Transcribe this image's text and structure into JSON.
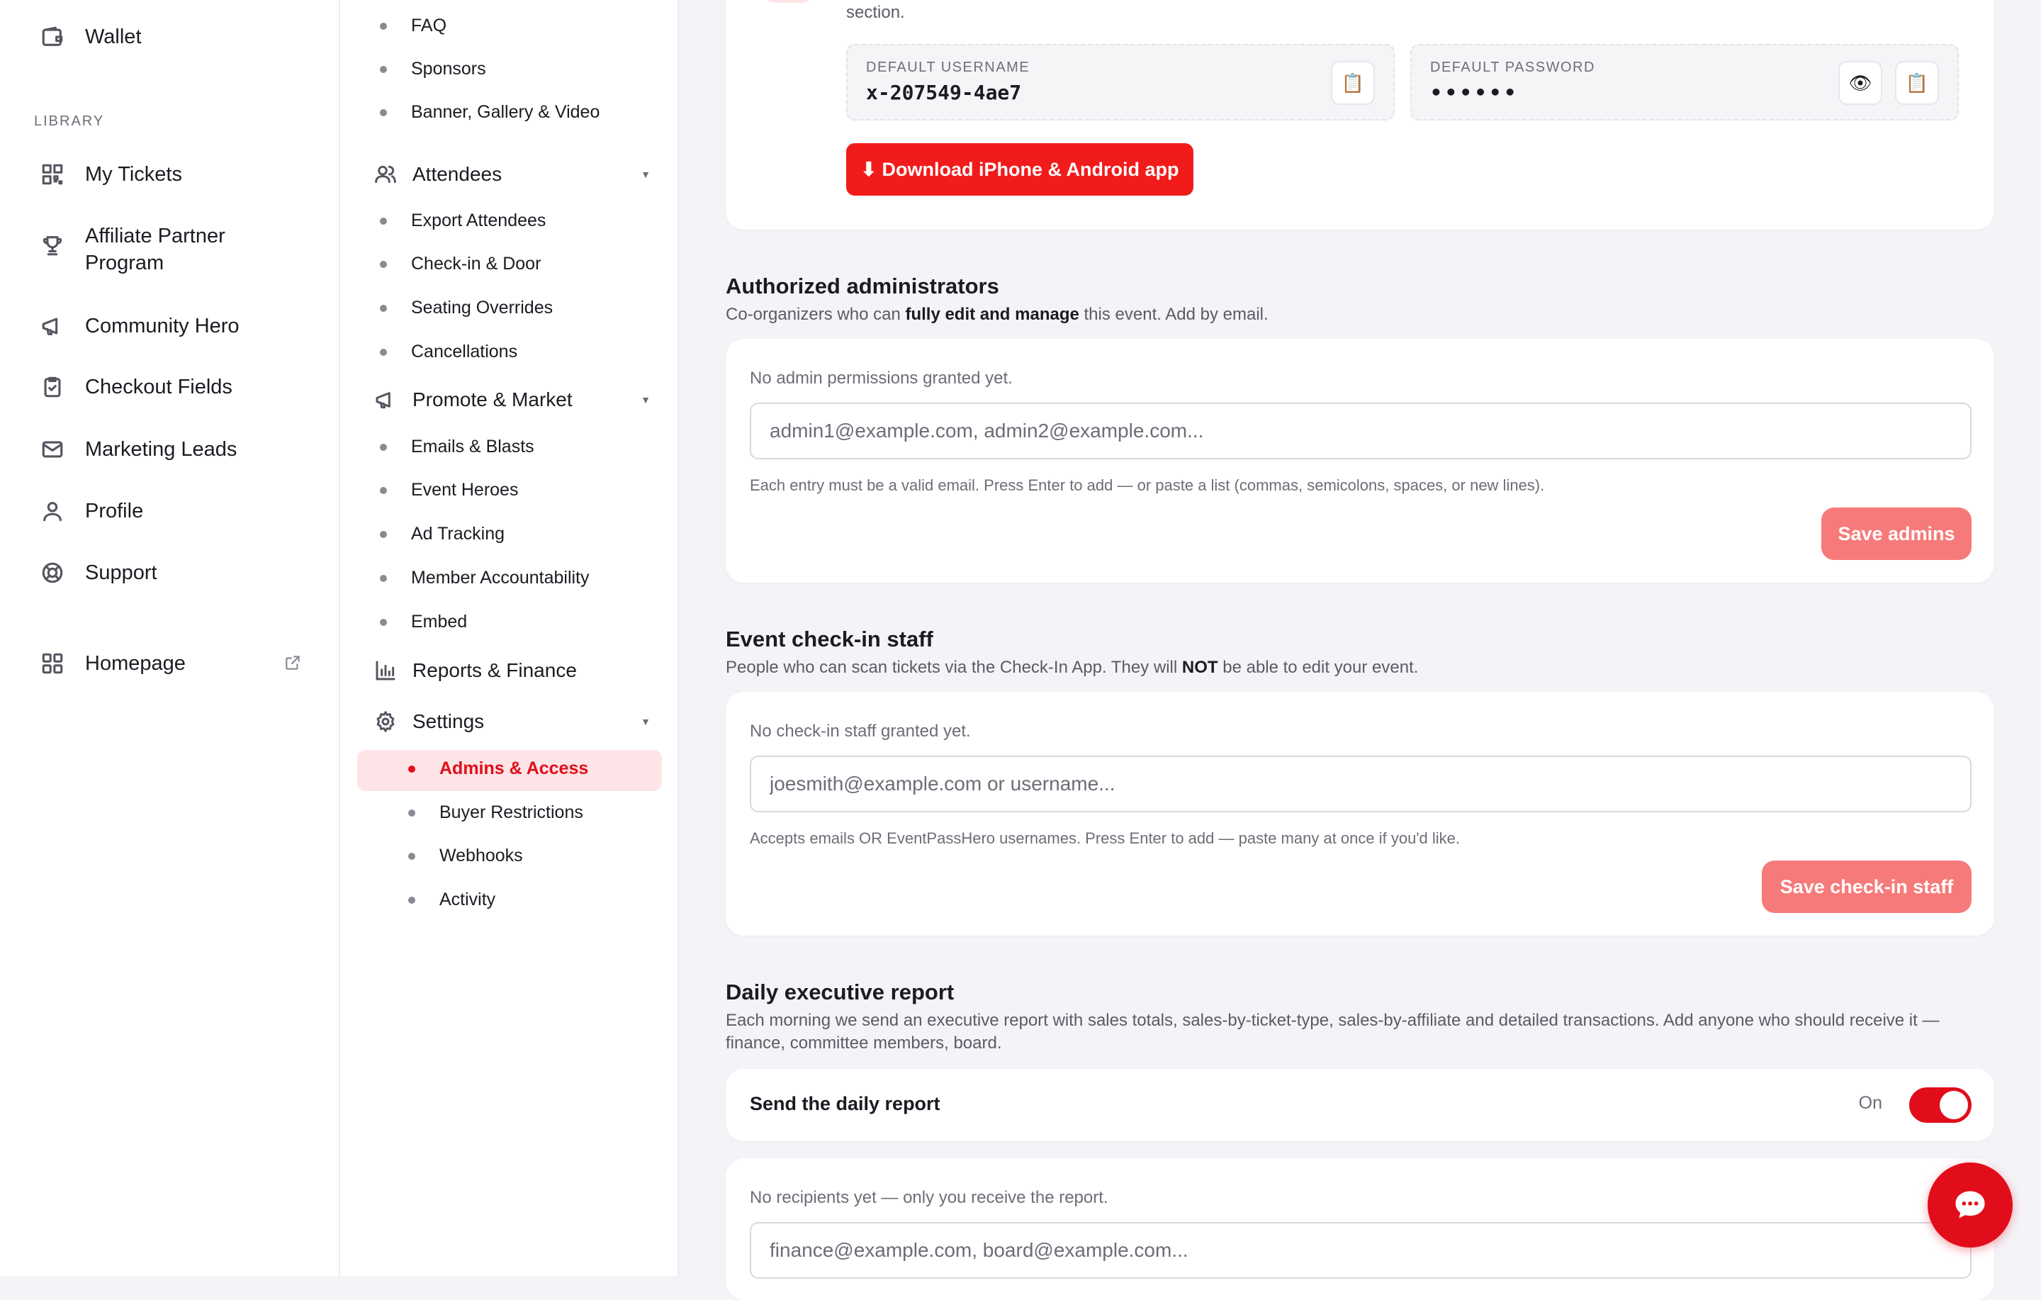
{
  "sidebar": {
    "wallet": "Wallet",
    "library_heading": "LIBRARY",
    "items": [
      {
        "label": "My Tickets",
        "icon": "qr-code-icon"
      },
      {
        "label": "Affiliate Partner Program",
        "icon": "trophy-icon"
      },
      {
        "label": "Community Hero",
        "icon": "megaphone-icon"
      },
      {
        "label": "Checkout Fields",
        "icon": "clipboard-check-icon"
      },
      {
        "label": "Marketing Leads",
        "icon": "mail-icon"
      },
      {
        "label": "Profile",
        "icon": "user-icon"
      },
      {
        "label": "Support",
        "icon": "lifebuoy-icon"
      }
    ],
    "homepage": "Homepage"
  },
  "subnav": {
    "top_leaves": [
      "FAQ",
      "Sponsors",
      "Banner, Gallery & Video"
    ],
    "attendees": {
      "label": "Attendees",
      "items": [
        "Export Attendees",
        "Check-in & Door",
        "Seating Overrides",
        "Cancellations"
      ]
    },
    "promote": {
      "label": "Promote & Market",
      "items": [
        "Emails & Blasts",
        "Event Heroes",
        "Ad Tracking",
        "Member Accountability",
        "Embed"
      ]
    },
    "reports": {
      "label": "Reports & Finance"
    },
    "settings": {
      "label": "Settings",
      "items": [
        "Admins & Access",
        "Buyer Restrictions",
        "Webhooks",
        "Activity"
      ],
      "active": "Admins & Access"
    }
  },
  "app_card": {
    "top_text": "section.",
    "username_label": "DEFAULT USERNAME",
    "username_value": "x-207549-4ae7",
    "password_label": "DEFAULT PASSWORD",
    "password_value": "••••••",
    "download_button": "⬇ Download iPhone & Android app"
  },
  "admins": {
    "title": "Authorized administrators",
    "desc_pre": "Co-organizers who can ",
    "desc_bold": "fully edit and manage",
    "desc_post": " this event. Add by email.",
    "empty": "No admin permissions granted yet.",
    "placeholder": "admin1@example.com, admin2@example.com...",
    "help": "Each entry must be a valid email. Press Enter to add — or paste a list (commas, semicolons, spaces, or new lines).",
    "save": "Save admins"
  },
  "staff": {
    "title": "Event check-in staff",
    "desc_pre": "People who can scan tickets via the Check-In App. They will ",
    "desc_bold": "NOT",
    "desc_post": " be able to edit your event.",
    "empty": "No check-in staff granted yet.",
    "placeholder": "joesmith@example.com or username...",
    "help": "Accepts emails OR EventPassHero usernames. Press Enter to add — paste many at once if you'd like.",
    "save": "Save check-in staff"
  },
  "report": {
    "title": "Daily executive report",
    "desc": "Each morning we send an executive report with sales totals, sales-by-ticket-type, sales-by-affiliate and detailed transactions. Add anyone who should receive it — finance, committee members, board.",
    "toggle_label": "Send the daily report",
    "toggle_state": "On",
    "empty": "No recipients yet — only you receive the report.",
    "placeholder": "finance@example.com, board@example.com..."
  },
  "colors": {
    "accent": "#e20d1a",
    "button_red": "#f21b1b",
    "button_pink": "#f77a7a",
    "active_bg": "#fde4e6"
  }
}
